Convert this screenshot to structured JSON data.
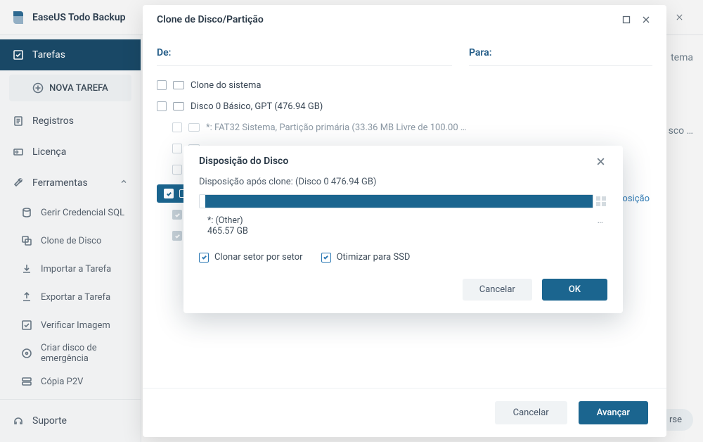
{
  "app": {
    "title": "EaseUS Todo Backup"
  },
  "sidebar": {
    "tasks": "Tarefas",
    "new_task": "NOVA TAREFA",
    "logs": "Registros",
    "license": "Licença",
    "tools": "Ferramentas",
    "manage_sql": "Gerir Credencial SQL",
    "disk_clone": "Clone de Disco",
    "import_task": "Importar a Tarefa",
    "export_task": "Exportar a Tarefa",
    "verify_image": "Verificar Imagem",
    "emergency_disk": "Criar disco de emergência",
    "p2v": "Cópia P2V",
    "support": "Suporte"
  },
  "backdrop": {
    "right_truncated_1": "tema",
    "right_truncated_2": "sco …",
    "bottom_btn": "rse"
  },
  "dialog": {
    "title": "Clone de Disco/Partição",
    "from": "De:",
    "to": "Para:",
    "items": {
      "system_clone": "Clone do sistema",
      "disk0": "Disco 0 Básico, GPT (476.94 GB)",
      "part_fat32": "*: FAT32 Sistema, Partição primária (33.36 MB Livre de 100.00 …"
    },
    "right_link": "osição",
    "cancel": "Cancelar",
    "next": "Avançar"
  },
  "inner": {
    "title": "Disposição do Disco",
    "after_clone": "Disposição após clone: (Disco 0 476.94 GB)",
    "part_name": "*: (Other)",
    "part_size": "465.57 GB",
    "ellipsis": "…",
    "opt_sector": "Clonar setor por setor",
    "opt_ssd": "Otimizar para SSD",
    "cancel": "Cancelar",
    "ok": "OK"
  }
}
